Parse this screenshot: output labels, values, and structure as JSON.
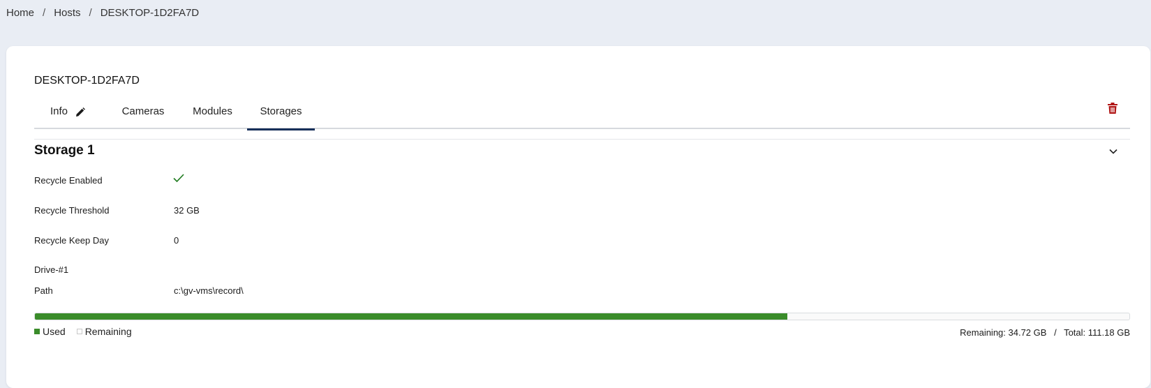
{
  "breadcrumb": {
    "items": [
      "Home",
      "Hosts",
      "DESKTOP-1D2FA7D"
    ],
    "separator": "/"
  },
  "host": {
    "title": "DESKTOP-1D2FA7D"
  },
  "tabs": {
    "items": [
      {
        "label": "Info",
        "icon": "pencil-icon"
      },
      {
        "label": "Cameras"
      },
      {
        "label": "Modules"
      },
      {
        "label": "Storages",
        "active": true
      }
    ]
  },
  "actions": {
    "delete_icon": "trash-icon",
    "delete_color": "#b01515"
  },
  "storage": {
    "title": "Storage 1",
    "collapse_icon": "chevron-down-icon",
    "rows": [
      {
        "label": "Recycle Enabled",
        "value": "",
        "icon": "checkmark-icon"
      },
      {
        "label": "Recycle Threshold",
        "value": "32 GB"
      },
      {
        "label": "Recycle Keep Day",
        "value": "0"
      }
    ],
    "drive": {
      "label": "Drive-#1",
      "path_label": "Path",
      "path_value": "c:\\gv-vms\\record\\"
    },
    "usage": {
      "used_fraction": 0.6877,
      "used_color": "#3a8c2a",
      "legend_used": "Used",
      "legend_remaining": "Remaining",
      "remaining_text": "Remaining: 34.72 GB",
      "separator": "/",
      "total_text": "Total: 111.18 GB"
    }
  }
}
